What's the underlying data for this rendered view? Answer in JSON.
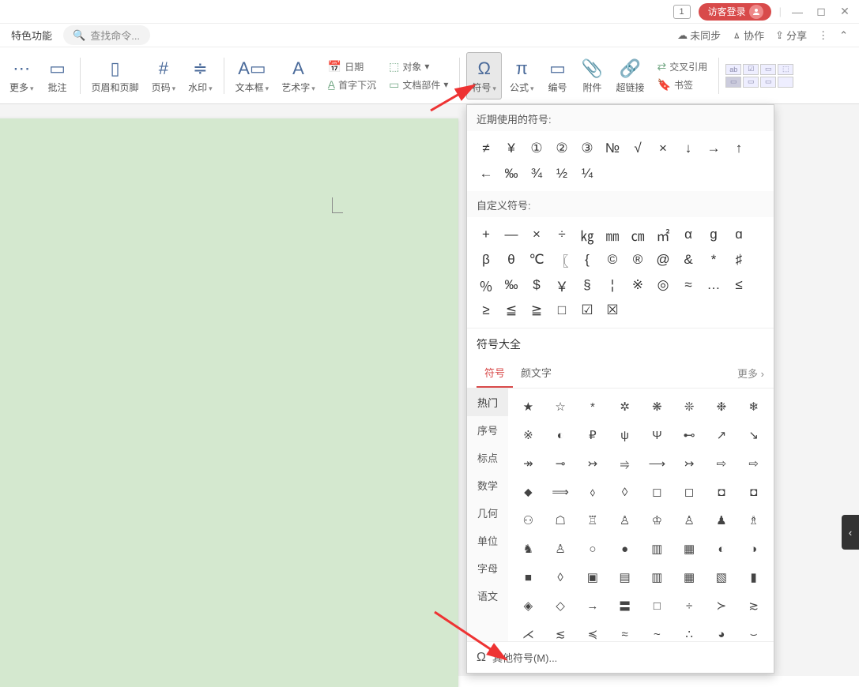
{
  "titlebar": {
    "tab_number": "1",
    "login": "访客登录"
  },
  "toolbar_top": {
    "feature": "特色功能",
    "search_placeholder": "查找命令...",
    "unsync": "未同步",
    "collab": "协作",
    "share": "分享"
  },
  "ribbon": {
    "more": "更多",
    "comment": "批注",
    "header_footer": "页眉和页脚",
    "page_number": "页码",
    "watermark": "水印",
    "textbox": "文本框",
    "wordart": "艺术字",
    "date": "日期",
    "dropcap": "首字下沉",
    "object": "对象",
    "doc_parts": "文档部件",
    "symbol": "符号",
    "formula": "公式",
    "numbering": "编号",
    "attachment": "附件",
    "hyperlink": "超链接",
    "crossref": "交叉引用",
    "bookmark": "书签"
  },
  "symbol_panel": {
    "recent_title": "近期使用的符号:",
    "recent": [
      "≠",
      "¥",
      "①",
      "②",
      "③",
      "№",
      "√",
      "×",
      "↓",
      "→",
      "↑",
      "←",
      "‰",
      "¾",
      "½",
      "¼"
    ],
    "custom_title": "自定义符号:",
    "custom": [
      "+",
      "—",
      "×",
      "÷",
      "㎏",
      "㎜",
      "㎝",
      "㎡",
      "α",
      "ɡ",
      "ɑ",
      "β",
      "θ",
      "℃",
      "〖",
      "{",
      "©",
      "®",
      "@",
      "&",
      "*",
      "♯",
      "％",
      "‰",
      "$",
      "￥",
      "§",
      "¦",
      "※",
      "◎",
      "≈",
      "…",
      "≤",
      "≥",
      "≦",
      "≧",
      "□",
      "☑",
      "☒"
    ],
    "all_title": "符号大全",
    "tab_symbol": "符号",
    "tab_emoji": "颜文字",
    "more": "更多",
    "categories": [
      "热门",
      "序号",
      "标点",
      "数学",
      "几何",
      "单位",
      "字母",
      "语文"
    ],
    "grid": [
      "★",
      "☆",
      "*",
      "✲",
      "❋",
      "❊",
      "❉",
      "❄",
      "※",
      "◐",
      "₽",
      "ψ",
      "Ψ",
      "⊷",
      "↗",
      "↘",
      "↠",
      "⊸",
      "↣",
      "⥤",
      "⟶",
      "↣",
      "⇨",
      "⇨",
      "⬥",
      "⟹",
      "⬨",
      "◊",
      "◻",
      "◻",
      "◘",
      "◘",
      "⚇",
      "☖",
      "♖",
      "♙",
      "♔",
      "♙",
      "♟",
      "♗",
      "♞",
      "♙",
      "○",
      "●",
      "▥",
      "▦",
      "◐",
      "◑",
      "■",
      "◊",
      "▣",
      "▤",
      "▥",
      "▦",
      "▧",
      "▮",
      "◈",
      "◇",
      "→",
      "〓",
      "□",
      "÷",
      "≻",
      "≳",
      "⋌",
      "≲",
      "≼",
      "≈",
      "~",
      "∴",
      "◕",
      "⌣"
    ],
    "footer": "其他符号(M)..."
  }
}
